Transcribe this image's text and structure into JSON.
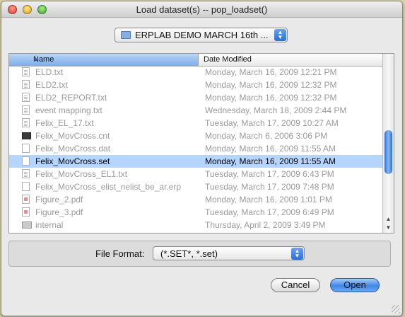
{
  "window": {
    "title": "Load dataset(s) -- pop_loadset()"
  },
  "path_popup": {
    "label": "ERPLAB DEMO MARCH 16th ..."
  },
  "browser": {
    "columns": {
      "name": "Name",
      "date": "Date Modified"
    },
    "rows": [
      {
        "icon": "doc",
        "name": "ELD.txt",
        "date": "Monday, March 16, 2009 12:21 PM"
      },
      {
        "icon": "doc",
        "name": "ELD2.txt",
        "date": "Monday, March 16, 2009 12:32 PM"
      },
      {
        "icon": "doc",
        "name": "ELD2_REPORT.txt",
        "date": "Monday, March 16, 2009 12:32 PM"
      },
      {
        "icon": "doc",
        "name": "event mapping.txt",
        "date": "Wednesday, March 18, 2009 2:44 PM"
      },
      {
        "icon": "doc",
        "name": "Felix_EL_17.txt",
        "date": "Tuesday, March 17, 2009 10:27 AM"
      },
      {
        "icon": "dark",
        "name": "Felix_MovCross.cnt",
        "date": "Monday, March 6, 2006 3:06 PM"
      },
      {
        "icon": "blank",
        "name": "Felix_MovCross.dat",
        "date": "Monday, March 16, 2009 11:55 AM"
      },
      {
        "icon": "blank",
        "name": "Felix_MovCross.set",
        "date": "Monday, March 16, 2009 11:55 AM",
        "selected": true
      },
      {
        "icon": "doc",
        "name": "Felix_MovCross_EL1.txt",
        "date": "Tuesday, March 17, 2009 6:43 PM"
      },
      {
        "icon": "blank",
        "name": "Felix_MovCross_elist_nelist_be_ar.erp",
        "date": "Tuesday, March 17, 2009 7:48 PM"
      },
      {
        "icon": "pdf",
        "name": "Figure_2.pdf",
        "date": "Monday, March 16, 2009 1:01 PM"
      },
      {
        "icon": "pdf",
        "name": "Figure_3.pdf",
        "date": "Tuesday, March 17, 2009 6:49 PM"
      },
      {
        "icon": "folder",
        "name": "internal",
        "date": "Thursday, April 2, 2009 3:49 PM"
      }
    ]
  },
  "file_format": {
    "label": "File Format:",
    "value": "(*.SET*, *.set)"
  },
  "buttons": {
    "cancel": "Cancel",
    "open": "Open"
  }
}
